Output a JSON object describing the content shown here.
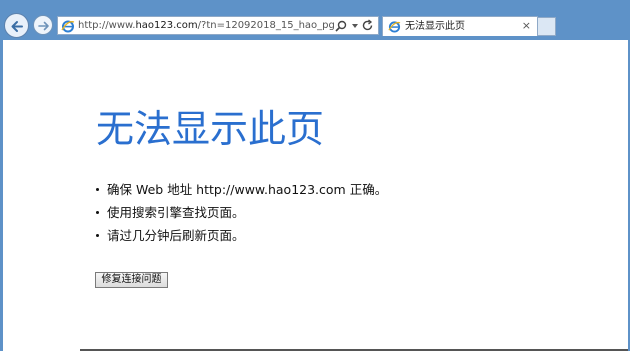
{
  "browser": {
    "address": {
      "prefix": "http://www.",
      "host": "hao123.com",
      "path": "/?tn=12092018_15_hao_pg"
    },
    "tab": {
      "title": "无法显示此页",
      "close": "×"
    }
  },
  "page": {
    "heading": "无法显示此页",
    "tips": [
      "确保 Web 地址 http://www.hao123.com 正确。",
      "使用搜索引擎查找页面。",
      "请过几分钟后刷新页面。"
    ],
    "fix_button": "修复连接问题"
  },
  "colors": {
    "chrome": "#5e92c8",
    "heading": "#2a6fcf"
  },
  "icons": [
    "back-arrow-icon",
    "forward-arrow-icon",
    "ie-logo-icon",
    "search-icon",
    "dropdown-icon",
    "refresh-icon",
    "close-icon"
  ]
}
